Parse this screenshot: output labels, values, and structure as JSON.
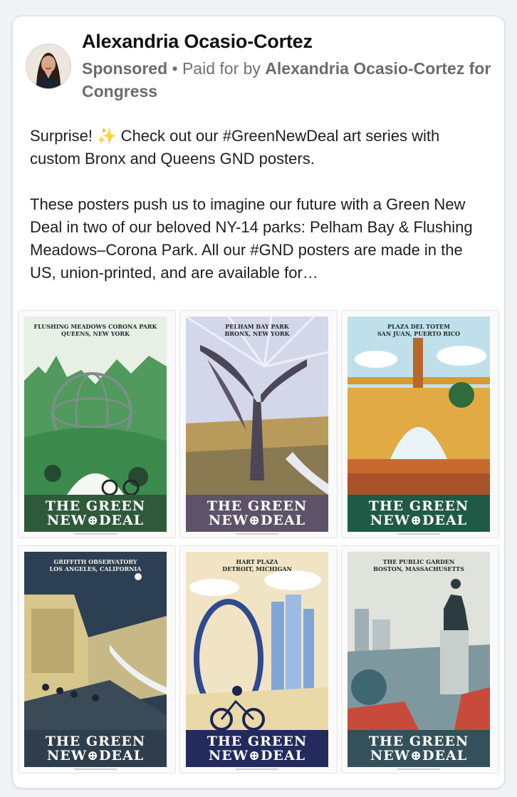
{
  "post": {
    "author": "Alexandria Ocasio-Cortez",
    "sponsored_label": "Sponsored",
    "paid_for_prefix": " • Paid for by ",
    "paid_for_by": "Alexandria Ocasio-Cortez for Congress",
    "paragraph1_a": "Surprise! ",
    "sparkles": "✨",
    "paragraph1_b": " Check out our #GreenNewDeal art series with custom Bronx and Queens GND posters.",
    "paragraph2": "These posters push us to imagine our future with a Green New Deal in two of our beloved NY-14 parks: Pelham Bay & Flushing Meadows–Corona Park. All our #GND posters are made in the US, union-printed, and are available for…"
  },
  "posters": [
    {
      "line1": "FLUSHING MEADOWS CORONA PARK",
      "line2": "QUEENS, NEW YORK",
      "title1": "THE GREEN",
      "title2": "NEW⊕DEAL",
      "band_color": "#2f5a3a",
      "sky": "#e7efe6",
      "mid": "#4f9a5c",
      "low": "#2f6b3d"
    },
    {
      "line1": "PELHAM BAY PARK",
      "line2": "BRONX, NEW YORK",
      "title1": "THE GREEN",
      "title2": "NEW⊕DEAL",
      "band_color": "#5d5268",
      "sky": "#cfd1e6",
      "mid": "#b89a5b",
      "low": "#6e6470"
    },
    {
      "line1": "PLAZA DEL TOTEM",
      "line2": "SAN JUAN, PUERTO RICO",
      "title1": "THE GREEN",
      "title2": "NEW⊕DEAL",
      "band_color": "#1f5a46",
      "sky": "#bfe0ea",
      "mid": "#d79a35",
      "low": "#c86a2f"
    },
    {
      "line1": "GRIFFITH OBSERVATORY",
      "line2": "LOS ANGELES, CALIFORNIA",
      "title1": "THE GREEN",
      "title2": "NEW⊕DEAL",
      "band_color": "#2f3e4c",
      "sky": "#2d3f52",
      "mid": "#d8c78c",
      "low": "#3b4a57"
    },
    {
      "line1": "HART PLAZA",
      "line2": "DETROIT, MICHIGAN",
      "title1": "THE GREEN",
      "title2": "NEW⊕DEAL",
      "band_color": "#232a5c",
      "sky": "#f1e4c4",
      "mid": "#7fa6d8",
      "low": "#2f4a8f"
    },
    {
      "line1": "THE PUBLIC GARDEN",
      "line2": "BOSTON, MASSACHUSETTS",
      "title1": "THE GREEN",
      "title2": "NEW⊕DEAL",
      "band_color": "#34505a",
      "sky": "#dfe3dc",
      "mid": "#7f98a0",
      "low": "#3f6673"
    }
  ]
}
